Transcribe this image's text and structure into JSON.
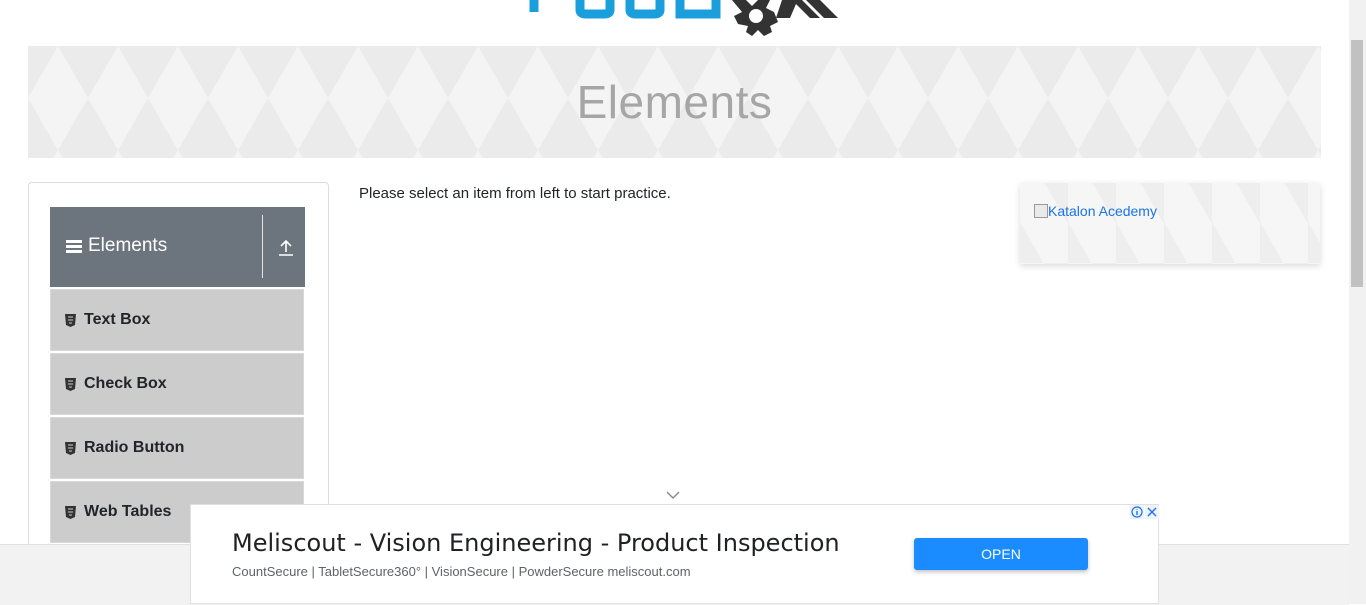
{
  "banner": {
    "title": "Elements"
  },
  "sidebar": {
    "group_title": "Elements",
    "items": [
      {
        "label": "Text Box"
      },
      {
        "label": "Check Box"
      },
      {
        "label": "Radio Button"
      },
      {
        "label": "Web Tables"
      }
    ]
  },
  "main": {
    "intro": "Please select an item from left to start practice."
  },
  "side_ad": {
    "alt_text": "Katalon Acedemy"
  },
  "bottom_ad": {
    "headline": "Meliscout - Vision Engineering - Product Inspection",
    "subtext": "CountSecure | TabletSecure360° | VisionSecure | PowderSecure meliscout.com",
    "button": "OPEN"
  },
  "colors": {
    "header_bg": "#6c757d",
    "item_bg": "#cccccc",
    "brand_blue": "#1a9fdc",
    "ad_button": "#1a8cff"
  }
}
